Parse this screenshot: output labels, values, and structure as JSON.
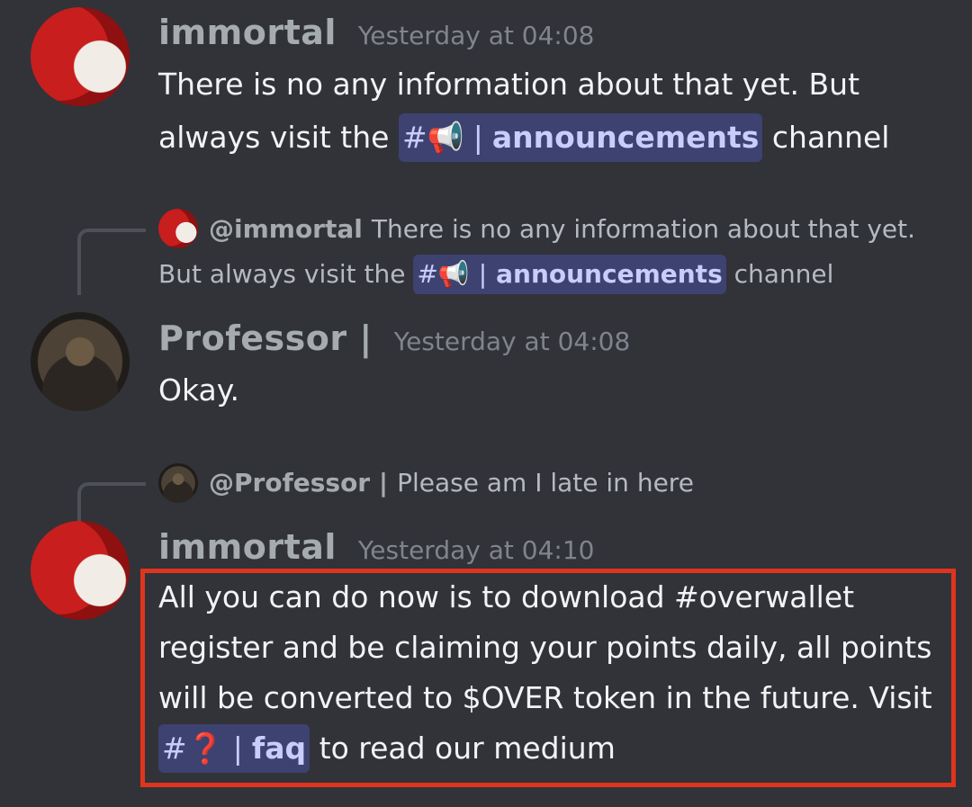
{
  "messages": [
    {
      "author": "immortal",
      "time": "Yesterday at 04:08",
      "line1": "There is no any information about that yet. But",
      "line2_prefix": "always visit the",
      "channel_hash": "#",
      "channel_emoji": "📢",
      "channel_sep": "|",
      "channel_name": "announcements",
      "line2_suffix": "channel"
    },
    {
      "reply": {
        "mention": "@immortal",
        "line1": "There is no any information about that yet.",
        "line2_prefix": "But always visit the",
        "channel_hash": "#",
        "channel_emoji": "📢",
        "channel_sep": "|",
        "channel_name": "announcements",
        "line2_suffix": "channel"
      },
      "author": "Professor |",
      "time": "Yesterday at 04:08",
      "text": "Okay."
    },
    {
      "reply": {
        "mention": "@Professor |",
        "text": "Please am I late in here"
      },
      "author": "immortal",
      "time": "Yesterday at 04:10",
      "line1": "All you can do now is to download #overwallet",
      "line2": "register and be claiming your points daily, all points",
      "line3": "will be converted to $OVER token in the future.  Visit",
      "channel_hash": "#",
      "channel_emoji": "❓",
      "channel_sep": "|",
      "channel_name": "faq",
      "line4_suffix": "to read our medium"
    }
  ],
  "colors": {
    "background": "#313338",
    "highlight_border": "#e0341e",
    "mention_bg": "#3d4270"
  }
}
